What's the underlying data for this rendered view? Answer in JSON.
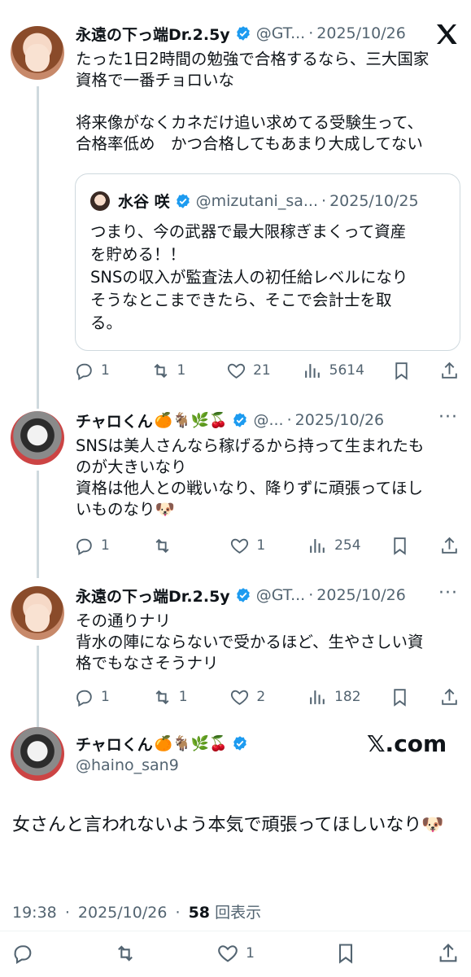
{
  "thread": [
    {
      "name": "永遠の下っ端Dr.2.5y",
      "handle": "@GT...",
      "date": "2025/10/26",
      "text": "たった1日2時間の勉強で合格するなら、三大国家\n資格で一番チョロいな\n\n将来像がなくカネだけ追い求めてる受験生って、\n合格率低め　かつ合格してもあまり大成してない",
      "quote": {
        "name": "水谷 咲",
        "handle": "@mizutani_sa...",
        "date": "2025/10/25",
        "text": "つまり、今の武器で最大限稼ぎまくって資産\nを貯める！！\nSNSの収入が監査法人の初任給レベルになり\nそうなとこまできたら、そこで会計士を取\nる。"
      },
      "replies": "1",
      "retweets": "1",
      "likes": "21",
      "views": "5614"
    },
    {
      "name": "チャロくん",
      "emojis": "🍊🐐🌿🍒",
      "handle": "@...",
      "date": "2025/10/26",
      "text": "SNSは美人さんなら稼げるから持って生まれたも\nのが大きいなり\n資格は他人との戦いなり、降りずに頑張ってほし\nいものなり🐶",
      "replies": "1",
      "retweets": "",
      "likes": "1",
      "views": "254"
    },
    {
      "name": "永遠の下っ端Dr.2.5y",
      "handle": "@GT...",
      "date": "2025/10/26",
      "text": "その通りナリ\n背水の陣にならないで受かるほど、生やさしい資\n格でもなさそうナリ",
      "replies": "1",
      "retweets": "1",
      "likes": "2",
      "views": "182"
    }
  ],
  "main": {
    "name": "チャロくん",
    "emojis": "🍊🐐🌿🍒",
    "handle": "@haino_san9",
    "watermark": "𝕏.com",
    "text": "女さんと言われないよう本気で頑張ってほしいなり🐶",
    "time": "19:38",
    "date": "2025/10/26",
    "views_count": "58",
    "views_label": "回表示",
    "likes": "1"
  },
  "colors": {
    "verified": "#1d9bf0",
    "muted": "#536471",
    "border": "#cfd9de"
  }
}
